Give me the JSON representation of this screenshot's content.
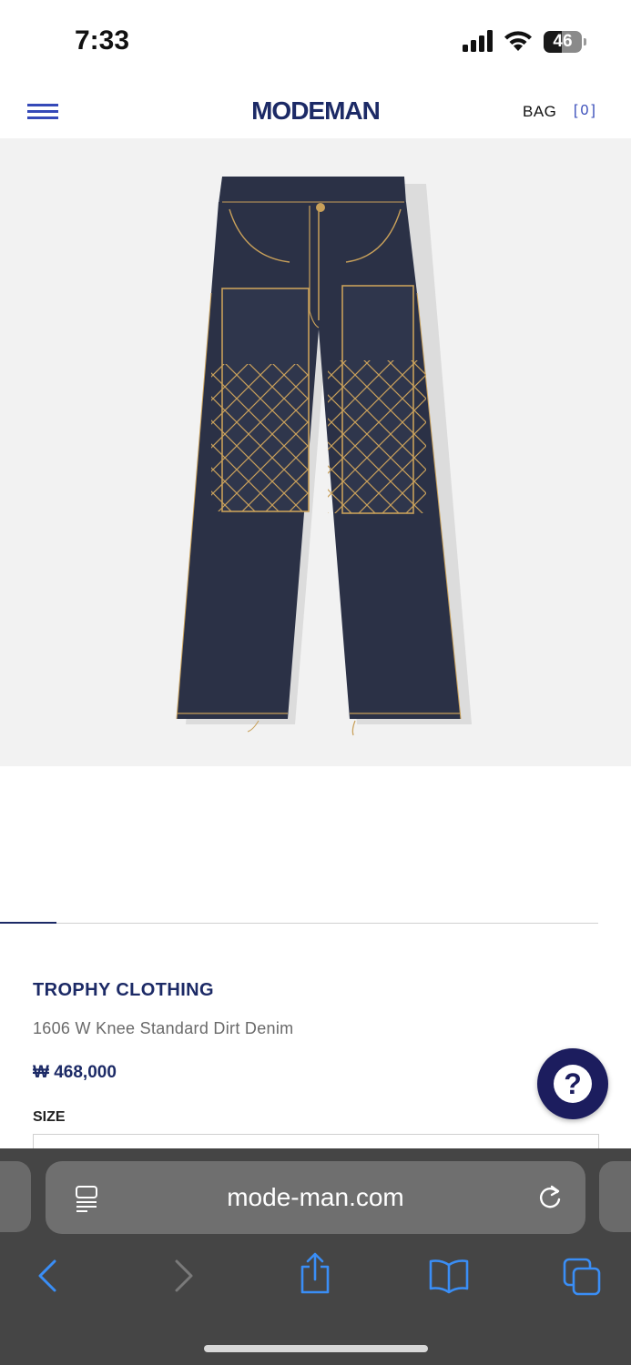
{
  "status_bar": {
    "time": "7:33",
    "battery_level": "46"
  },
  "header": {
    "logo": "MODEMAN",
    "bag_label": "BAG",
    "bag_count": "[0]"
  },
  "gallery": {
    "current_index": 1,
    "progress_fraction": 0.094
  },
  "product": {
    "brand": "TROPHY CLOTHING",
    "name": "1606 W Knee Standard Dirt Denim",
    "price": "₩ 468,000",
    "size_label": "SIZE",
    "image_colors": {
      "denim": "#2b3146",
      "stitch": "#c8a05a",
      "background": "#f2f2f2"
    }
  },
  "help": {
    "icon": "question-mark-icon"
  },
  "browser": {
    "url": "mode-man.com",
    "reader_icon": "reader-icon",
    "reload_icon": "reload-icon",
    "toolbar_icons": [
      "back-icon",
      "forward-icon",
      "share-icon",
      "bookmarks-icon",
      "tabs-icon"
    ],
    "accent_color": "#3a8ef6"
  },
  "colors": {
    "brand_navy": "#1c2a66",
    "accent_blue": "#3549b8"
  }
}
